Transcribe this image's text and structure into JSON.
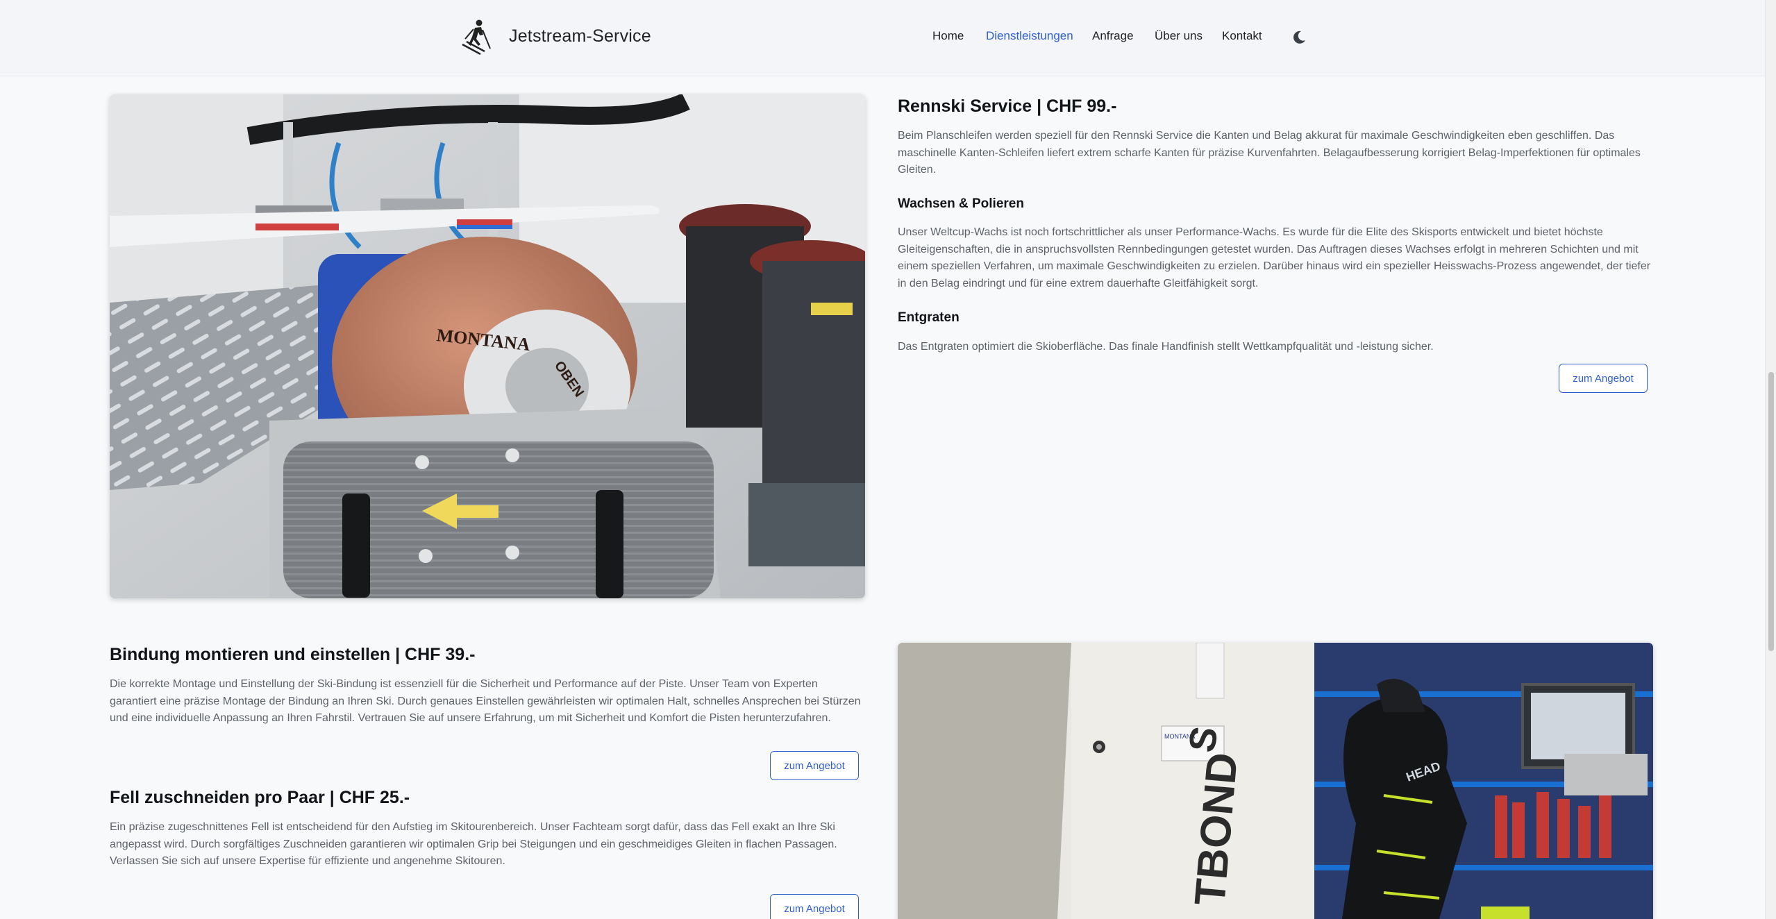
{
  "header": {
    "brand": "Jetstream-Service",
    "logo_icon": "skier-icon",
    "nav": [
      {
        "label": "Home",
        "active": false
      },
      {
        "label": "Dienstleistungen",
        "active": true
      },
      {
        "label": "Anfrage",
        "active": false
      },
      {
        "label": "Über uns",
        "active": false
      },
      {
        "label": "Kontakt",
        "active": false
      }
    ],
    "theme_icon": "moon-icon",
    "accent_color": "#2f5fd0"
  },
  "services": {
    "rennski": {
      "title": "Rennski Service | CHF 99.-",
      "intro": "Beim Planschleifen werden speziell für den Rennski Service die Kanten und Belag akkurat für maximale Geschwindigkeiten eben geschliffen. Das maschinelle Kanten-Schleifen liefert extrem scharfe Kanten für präzise Kurvenfahrten. Belagaufbesserung korrigiert Belag-Imperfektionen für optimales Gleiten.",
      "wax_title": "Wachsen & Polieren",
      "wax_text": "Unser Weltcup-Wachs ist noch fortschrittlicher als unser Performance-Wachs. Es wurde für die Elite des Skisports entwickelt und bietet höchste Gleiteigenschaften, die in anspruchsvollsten Rennbedingungen getestet wurden. Das Auftragen dieses Wachses erfolgt in mehreren Schichten und mit einem speziellen Verfahren, um maximale Geschwindigkeiten zu erzielen. Darüber hinaus wird ein spezieller Heisswachs-Prozess angewendet, der tiefer in den Belag eindringt und für eine extrem dauerhafte Gleitfähigkeit sorgt.",
      "deburr_title": "Entgraten",
      "deburr_text": "Das Entgraten optimiert die Skioberfläche. Das finale Handfinish stellt Wettkampfqualität und -leistung sicher.",
      "button": "zum Angebot"
    },
    "bindung": {
      "title": "Bindung montieren und einstellen | CHF 39.-",
      "text": "Die korrekte Montage und Einstellung der Ski-Bindung ist essenziell für die Sicherheit und Performance auf der Piste. Unser Team von Experten garantiert eine präzise Montage der Bindung an Ihren Ski. Durch genaues Einstellen gewährleisten wir optimalen Halt, schnelles Ansprechen bei Stürzen und eine individuelle Anpassung an Ihren Fahrstil. Vertrauen Sie auf unsere Erfahrung, um mit Sicherheit und Komfort die Pisten herunterzufahren.",
      "button": "zum Angebot"
    },
    "fell": {
      "title": "Fell zuschneiden pro Paar | CHF 25.-",
      "text": "Ein präzise zugeschnittenes Fell ist entscheidend für den Aufstieg im Skitourenbereich. Unser Fachteam sorgt dafür, dass das Fell exakt an Ihre Ski angepasst wird. Durch sorgfältiges Zuschneiden garantieren wir optimalen Grip bei Steigungen und ein geschmeidiges Gleiten in flachen Passagen. Verlassen Sie sich auf unsere Expertise für effiziente und angenehme Skitouren.",
      "button": "zum Angebot"
    }
  },
  "photos": {
    "machine_label": "MONTANA",
    "machine_label2": "OBEN",
    "binding_label": "TBOND",
    "binding_mark": "S",
    "boot_label": "HEAD",
    "sticker_label": "MONTANA"
  }
}
